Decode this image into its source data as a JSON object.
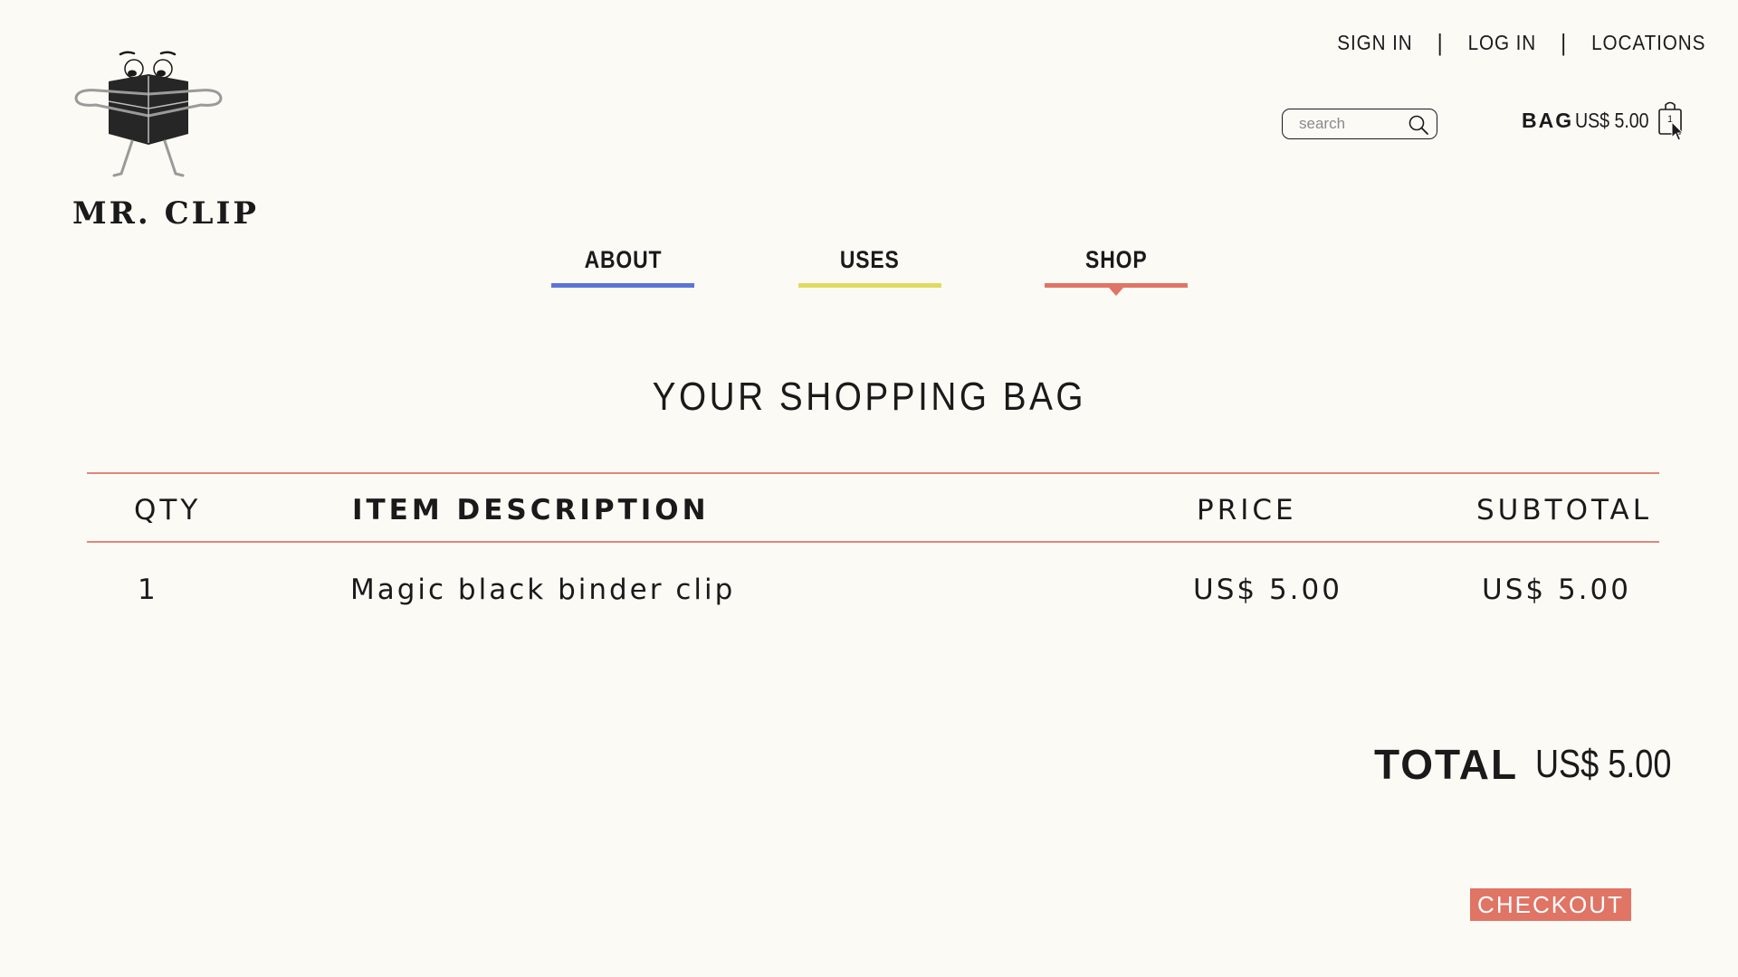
{
  "brand": {
    "name": "MR. CLIP"
  },
  "top_nav": {
    "sign_in": "SIGN IN",
    "log_in": "LOG IN",
    "locations": "LOCATIONS",
    "separator": "|"
  },
  "search": {
    "placeholder": "search",
    "icon": "search-icon"
  },
  "bag": {
    "label": "BAG",
    "amount": "US$ 5.00",
    "count": "1",
    "icon": "shopping-bag-icon"
  },
  "main_nav": {
    "tabs": [
      {
        "label": "ABOUT",
        "color": "#5b74d9"
      },
      {
        "label": "USES",
        "color": "#e0db5f"
      },
      {
        "label": "SHOP",
        "color": "#e07465",
        "active": true
      }
    ]
  },
  "page": {
    "title": "YOUR SHOPPING BAG"
  },
  "cart_table": {
    "headers": {
      "qty": "QTY",
      "item": "ITEM DESCRIPTION",
      "price": "PRICE",
      "subtotal": "SUBTOTAL"
    },
    "rows": [
      {
        "qty": "1",
        "item": "Magic black binder clip",
        "price": "US$ 5.00",
        "subtotal": "US$ 5.00"
      }
    ],
    "rule_color": "#e0867a"
  },
  "summary": {
    "total_label": "TOTAL",
    "total_value": "US$ 5.00"
  },
  "checkout": {
    "label": "CHECKOUT",
    "color": "#e07465"
  }
}
